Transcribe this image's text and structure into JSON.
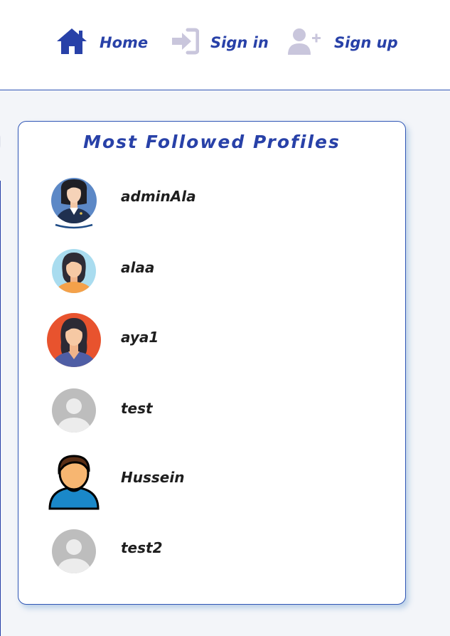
{
  "nav": {
    "home_label": "Home",
    "signin_label": "Sign in",
    "signup_label": "Sign up",
    "home_icon": "home-icon",
    "signin_icon": "sign-in-icon",
    "signup_icon": "user-plus-icon"
  },
  "profiles_card": {
    "title": "Most Followed Profiles",
    "profiles": [
      {
        "name": "adminAla",
        "avatar": "woman-business-avatar"
      },
      {
        "name": "alaa",
        "avatar": "woman-avatar"
      },
      {
        "name": "aya1",
        "avatar": "woman-avatar"
      },
      {
        "name": "test",
        "avatar": "default-user-avatar"
      },
      {
        "name": "Hussein",
        "avatar": "man-avatar"
      },
      {
        "name": "test2",
        "avatar": "default-user-avatar"
      }
    ]
  },
  "colors": {
    "accent": "#2841a8",
    "nav_icon_muted": "#c9c6dc",
    "background": "#f3f5f9",
    "card_border": "#2f55b5"
  }
}
